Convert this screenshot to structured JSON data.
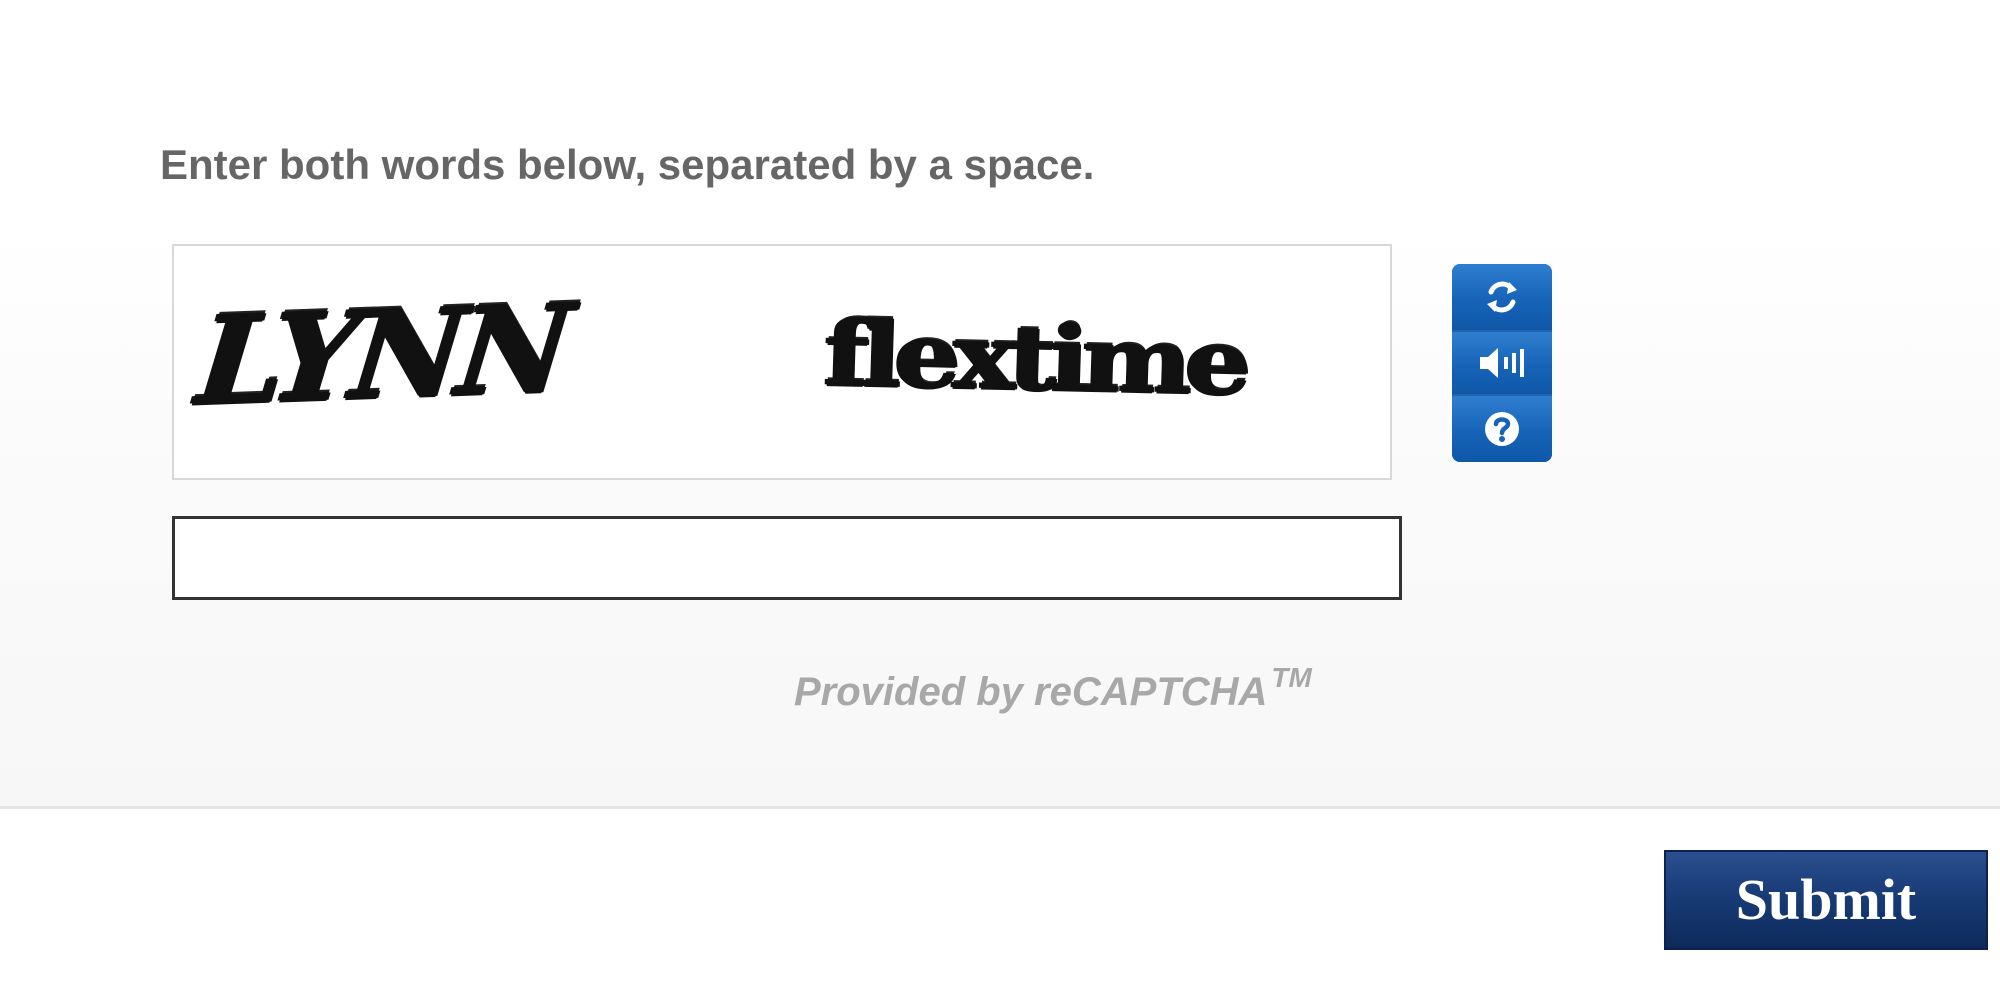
{
  "captcha": {
    "instruction": "Enter both words below, separated by a space.",
    "words": [
      "LYNN",
      "flextime"
    ],
    "answer": {
      "value": "",
      "placeholder": ""
    },
    "provider": "Provided by reCAPTCHA",
    "trademark": "TM",
    "tools": [
      {
        "name": "reload",
        "icon": "refresh-icon"
      },
      {
        "name": "audio",
        "icon": "speaker-icon"
      },
      {
        "name": "help",
        "icon": "help-icon"
      }
    ]
  },
  "form": {
    "submit_label": "Submit"
  },
  "colors": {
    "tool_blue": "#1663b8",
    "submit_navy": "#173a74",
    "instruction_gray": "#666666",
    "provider_gray": "#a8a8a8"
  }
}
